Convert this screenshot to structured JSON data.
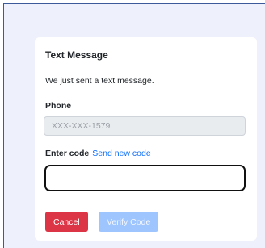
{
  "card": {
    "title": "Text Message",
    "description": "We just sent a text message."
  },
  "phone": {
    "label": "Phone",
    "value": "XXX-XXX-1579"
  },
  "code": {
    "label": "Enter code",
    "resend_link": "Send new code",
    "value": ""
  },
  "buttons": {
    "cancel": "Cancel",
    "verify": "Verify Code"
  },
  "colors": {
    "background": "#eef1fb",
    "cancel": "#dc3545",
    "verify_disabled": "#9ec5fe",
    "link": "#0d6efd"
  }
}
